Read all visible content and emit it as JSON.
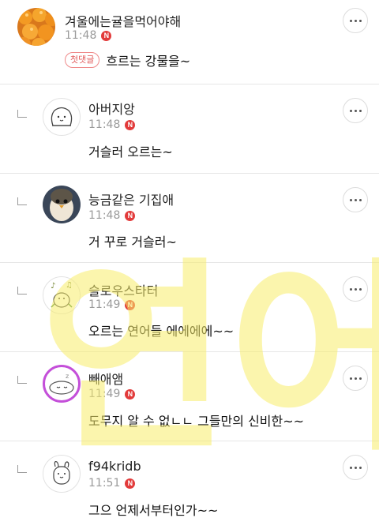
{
  "comments": [
    {
      "name": "겨울에는귤을먹어야해",
      "time": "11:48",
      "badge": "N",
      "first_label": "첫댓글",
      "text": "흐르는 강물을~"
    },
    {
      "name": "아버지앙",
      "time": "11:48",
      "badge": "N",
      "text": "거슬러 오르는~"
    },
    {
      "name": "능금같은 기집애",
      "time": "11:48",
      "badge": "N",
      "text": "거 꾸로 거슬러~"
    },
    {
      "name": "슬로우스타터",
      "time": "11:49",
      "badge": "N",
      "text": "오르는 연어들 에에에에~~"
    },
    {
      "name": "빼애앰",
      "time": "11:49",
      "badge": "N",
      "text": "도무지 알 수 없ㄴㄴ 그들만의 신비한~~"
    },
    {
      "name": "f94kridb",
      "time": "11:51",
      "badge": "N",
      "text": "그으 언제서부터인가~~"
    }
  ],
  "icons": {
    "more": "more-options-icon",
    "reply": "reply-indent-icon",
    "new": "new-badge"
  },
  "colors": {
    "new_badge": "#e23b3b",
    "first_badge": "#e25a5a",
    "watermark": "#f7ec6a",
    "ring": "#c44fd9"
  },
  "watermark_text": "연어"
}
